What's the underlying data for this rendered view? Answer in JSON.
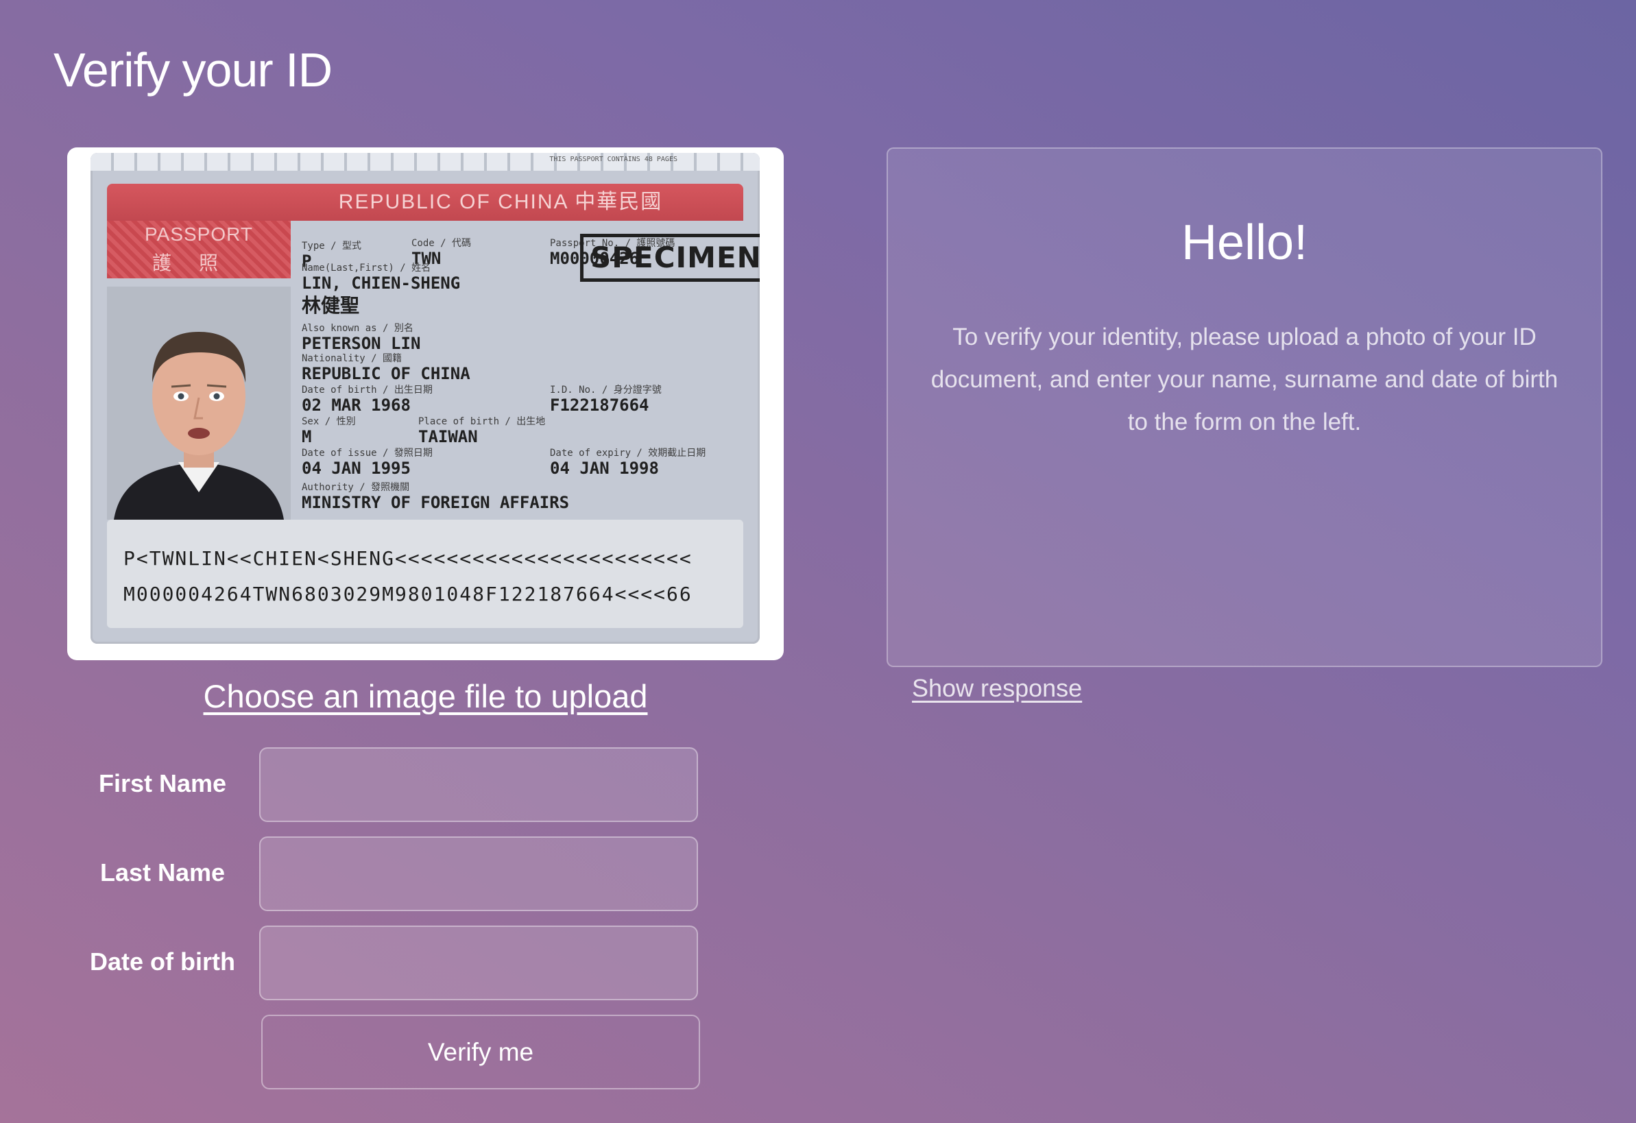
{
  "page": {
    "title": "Verify your ID"
  },
  "id_document": {
    "banner": "REPUBLIC OF CHINA 中華民國",
    "doc_word": "PASSPORT",
    "doc_word_cjk": "護照",
    "fine_print": "THIS PASSPORT CONTAINS 48 PAGES",
    "fields": {
      "type": {
        "label": "Type / 型式",
        "value": "P"
      },
      "code": {
        "label": "Code / 代碼",
        "value": "TWN"
      },
      "passport_no": {
        "label": "Passport No. / 護照號碼",
        "value": "M00000426"
      },
      "name": {
        "label": "Name(Last,First) / 姓名",
        "value": "LIN, CHIEN-SHENG",
        "value_cjk": "林健聖"
      },
      "aka": {
        "label": "Also known as / 別名",
        "value": "PETERSON LIN"
      },
      "nationality": {
        "label": "Nationality / 國籍",
        "value": "REPUBLIC OF CHINA"
      },
      "dob": {
        "label": "Date of birth / 出生日期",
        "value": "02 MAR 1968"
      },
      "id_no": {
        "label": "I.D. No. / 身分證字號",
        "value": "F122187664"
      },
      "sex": {
        "label": "Sex / 性別",
        "value": "M"
      },
      "place_of_birth": {
        "label": "Place of birth / 出生地",
        "value": "TAIWAN"
      },
      "date_of_issue": {
        "label": "Date of issue / 發照日期",
        "value": "04 JAN 1995"
      },
      "date_of_expiry": {
        "label": "Date of expiry / 效期截止日期",
        "value": "04 JAN 1998"
      },
      "authority": {
        "label": "Authority / 發照機關",
        "value": "MINISTRY OF FOREIGN AFFAIRS"
      }
    },
    "stamp": "SPECIMEN",
    "mrz_line1": "P<TWNLIN<<CHIEN<SHENG<<<<<<<<<<<<<<<<<<<<<<<",
    "mrz_line2": "M000004264TWN6803029M9801048F122187664<<<<66"
  },
  "upload": {
    "link_label": "Choose an image file to upload"
  },
  "form": {
    "first_name_label": "First Name",
    "first_name_value": "",
    "last_name_label": "Last Name",
    "last_name_value": "",
    "dob_label": "Date of birth",
    "dob_value": "",
    "submit_label": "Verify me"
  },
  "response": {
    "title": "Hello!",
    "text": "To verify your identity, please upload a photo of your ID document, and enter your name, surname and date of birth to the form on the left.",
    "show_link": "Show response"
  },
  "colors": {
    "background_start": "#6c65a3",
    "background_end": "#a5739a",
    "passport_red": "#c24850",
    "passport_page": "#c4c9d4"
  }
}
